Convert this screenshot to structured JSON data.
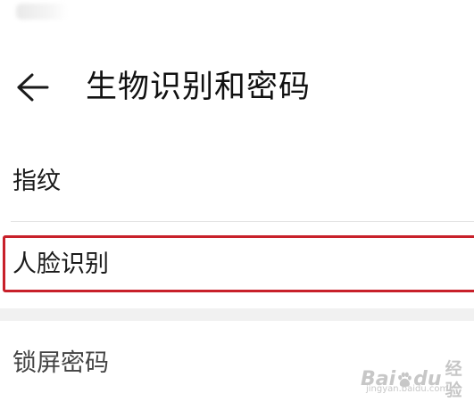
{
  "header": {
    "back_icon": "arrow-left-icon",
    "title": "生物识别和密码"
  },
  "settings": {
    "items": [
      {
        "label": "指纹"
      },
      {
        "label": "人脸识别",
        "highlight_color": "#c8202a"
      },
      {
        "label": "锁屏密码"
      }
    ]
  },
  "watermark": {
    "brand_left": "Bai",
    "brand_right": "du",
    "brand_cn": "经验",
    "url": "jingyan.baidu.com"
  },
  "colors": {
    "background": "#ffffff",
    "text": "#1a1a1a",
    "highlight_border": "#c8202a",
    "divider": "#e4e4e4",
    "section_gap": "#f1f1f1"
  }
}
